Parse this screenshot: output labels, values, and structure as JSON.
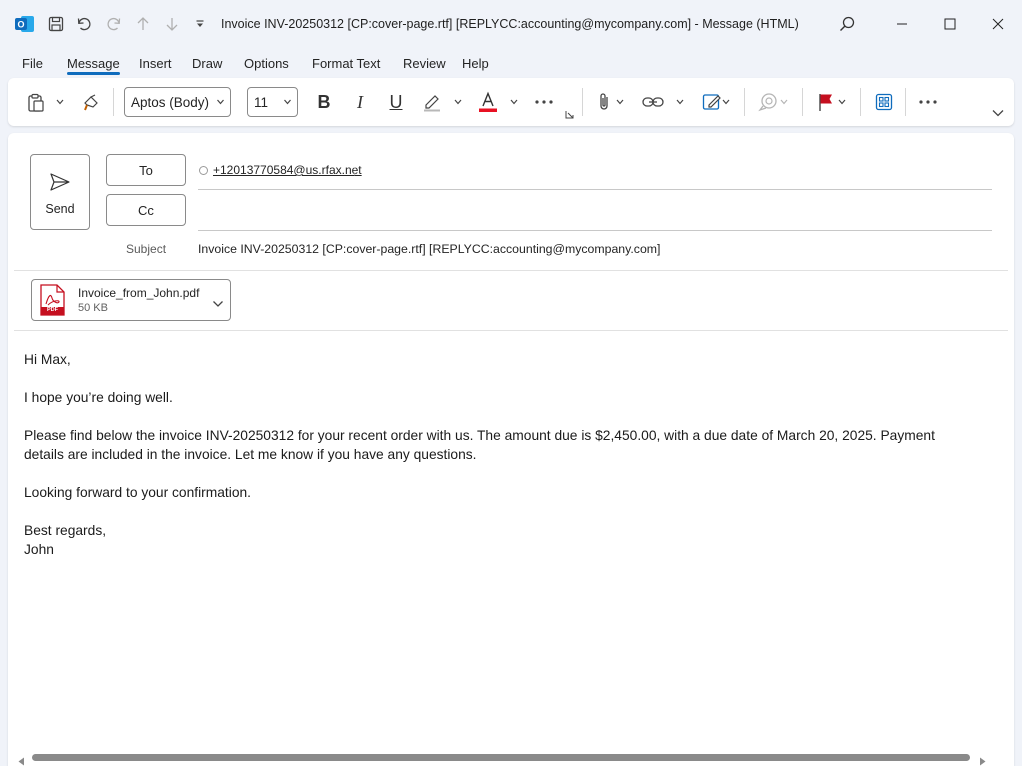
{
  "window": {
    "title": "Invoice INV-20250312 [CP:cover-page.rtf] [REPLYCC:accounting@mycompany.com]  -  Message (HTML)"
  },
  "menu": {
    "items": [
      "File",
      "Message",
      "Insert",
      "Draw",
      "Options",
      "Format Text",
      "Review",
      "Help"
    ]
  },
  "ribbon": {
    "font_name": "Aptos (Body)",
    "font_size": "11"
  },
  "compose": {
    "send_label": "Send",
    "to_label": "To",
    "cc_label": "Cc",
    "to_value": "+12013770584@us.rfax.net",
    "to_sep": ";",
    "cc_value": "",
    "subject_label": "Subject",
    "subject_value": "Invoice INV-20250312 [CP:cover-page.rtf] [REPLYCC:accounting@mycompany.com]"
  },
  "attachment": {
    "name": "Invoice_from_John.pdf",
    "size": "50 KB",
    "badge": "PDF"
  },
  "body": {
    "greeting": "Hi Max,",
    "line1": "I hope you’re doing well.",
    "para_a": "Please find below the invoice INV-20250312 for your recent order with us. The amount due is $2,450.00, with a due date of March 20, 2025. Payment",
    "para_b": "details are included in the invoice. Let me know if you have any questions.",
    "line3": "Looking forward to your confirmation.",
    "closing": "Best regards,",
    "signature": "John"
  },
  "colors": {
    "accent": "#0f6cbd",
    "font_color_bar": "#e81123",
    "flag": "#c50f1f",
    "pdf": "#c50f1f"
  }
}
